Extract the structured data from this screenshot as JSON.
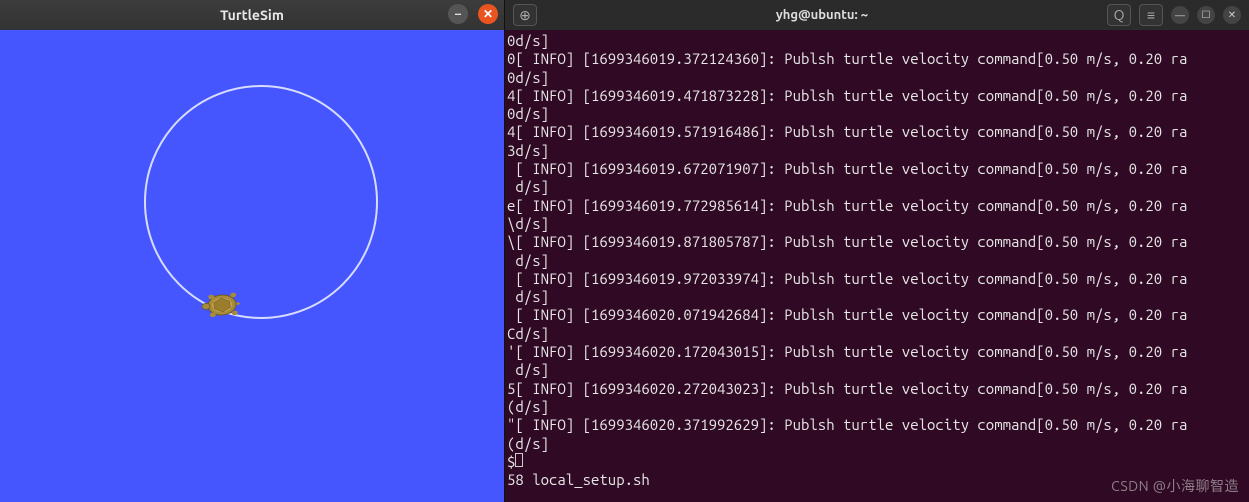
{
  "turtlesim": {
    "title": "TurtleSim",
    "canvas_color": "#4556ff",
    "path_color": "#d7dcff"
  },
  "terminal": {
    "title": "yhg@ubuntu: ~",
    "search_icon": "Q",
    "menu_icon": "≡",
    "min_icon": "—",
    "max_icon": "☐",
    "close_icon": "✕",
    "new_tab_icon": "⊕",
    "lines": [
      "0d/s]",
      "0[ INFO] [1699346019.372124360]: Publsh turtle velocity command[0.50 m/s, 0.20 ra",
      "0d/s]",
      "4[ INFO] [1699346019.471873228]: Publsh turtle velocity command[0.50 m/s, 0.20 ra",
      "0d/s]",
      "4[ INFO] [1699346019.571916486]: Publsh turtle velocity command[0.50 m/s, 0.20 ra",
      "3d/s]",
      " [ INFO] [1699346019.672071907]: Publsh turtle velocity command[0.50 m/s, 0.20 ra",
      " d/s]",
      "e[ INFO] [1699346019.772985614]: Publsh turtle velocity command[0.50 m/s, 0.20 ra",
      "\\d/s]",
      "\\[ INFO] [1699346019.871805787]: Publsh turtle velocity command[0.50 m/s, 0.20 ra",
      " d/s]",
      " [ INFO] [1699346019.972033974]: Publsh turtle velocity command[0.50 m/s, 0.20 ra",
      " d/s]",
      " [ INFO] [1699346020.071942684]: Publsh turtle velocity command[0.50 m/s, 0.20 ra",
      "Cd/s]",
      "'[ INFO] [1699346020.172043015]: Publsh turtle velocity command[0.50 m/s, 0.20 ra",
      " d/s]",
      "5[ INFO] [1699346020.272043023]: Publsh turtle velocity command[0.50 m/s, 0.20 ra",
      "(d/s]",
      "\"[ INFO] [1699346020.371992629]: Publsh turtle velocity command[0.50 m/s, 0.20 ra",
      "(d/s]",
      "$",
      "58 local_setup.sh"
    ]
  },
  "watermark": "CSDN @小海聊智造"
}
